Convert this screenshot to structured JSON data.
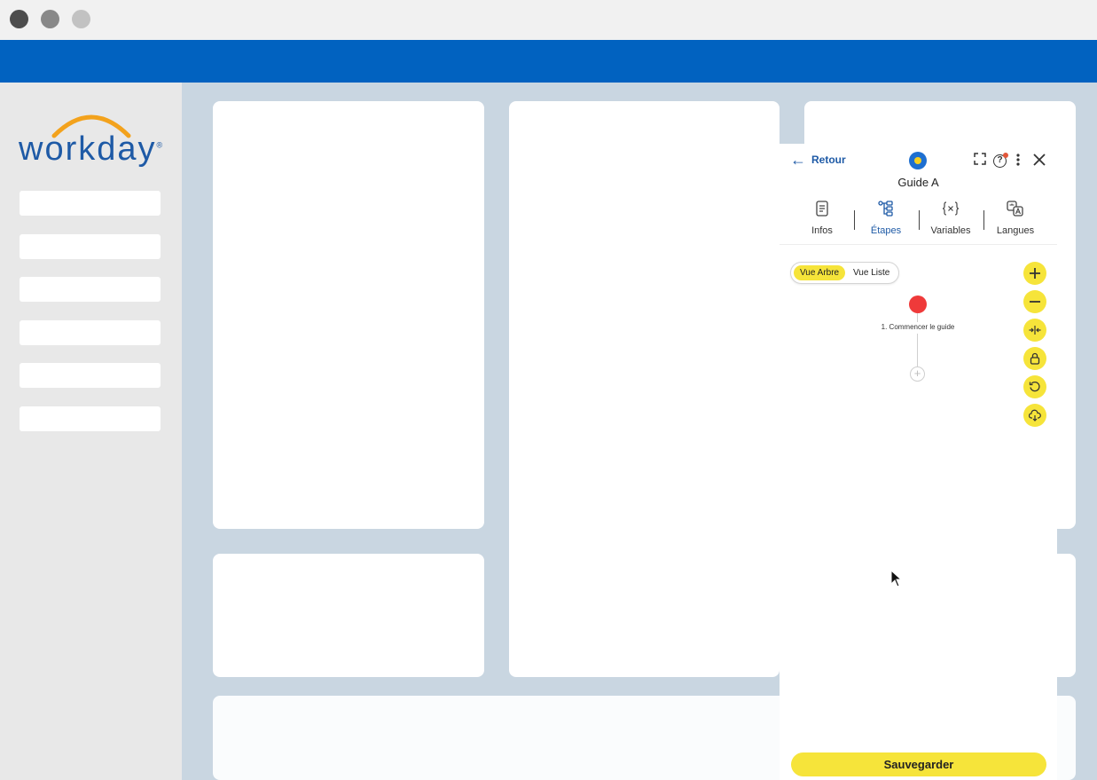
{
  "window": {
    "controls": [
      "close",
      "minimize",
      "zoom"
    ]
  },
  "sidebar": {
    "logo_text": "workday",
    "logo_mark": "®",
    "items": [
      "",
      "",
      "",
      "",
      "",
      ""
    ]
  },
  "panel": {
    "back_label": "Retour",
    "title": "Guide A",
    "help_label": "?",
    "tabs": [
      {
        "label": "Infos",
        "icon": "document-icon"
      },
      {
        "label": "Étapes",
        "icon": "tree-icon"
      },
      {
        "label": "Variables",
        "icon": "variables-icon"
      },
      {
        "label": "Langues",
        "icon": "translate-icon"
      }
    ],
    "active_tab": "Étapes",
    "view_toggle": {
      "tree_label": "Vue Arbre",
      "list_label": "Vue Liste",
      "selected": "Vue Arbre"
    },
    "tree": {
      "start_step_label": "1. Commencer le guide"
    },
    "tools": [
      "zoom-in-icon",
      "zoom-out-icon",
      "collapse-icon",
      "lock-icon",
      "reset-icon",
      "cloud-download-icon"
    ],
    "save_label": "Sauvegarder"
  },
  "colors": {
    "brand_blue": "#0162c0",
    "background": "#c9d6e1",
    "accent_yellow": "#f6e43a",
    "start_node_red": "#ef3a3a",
    "link_blue": "#1e5aa6"
  }
}
